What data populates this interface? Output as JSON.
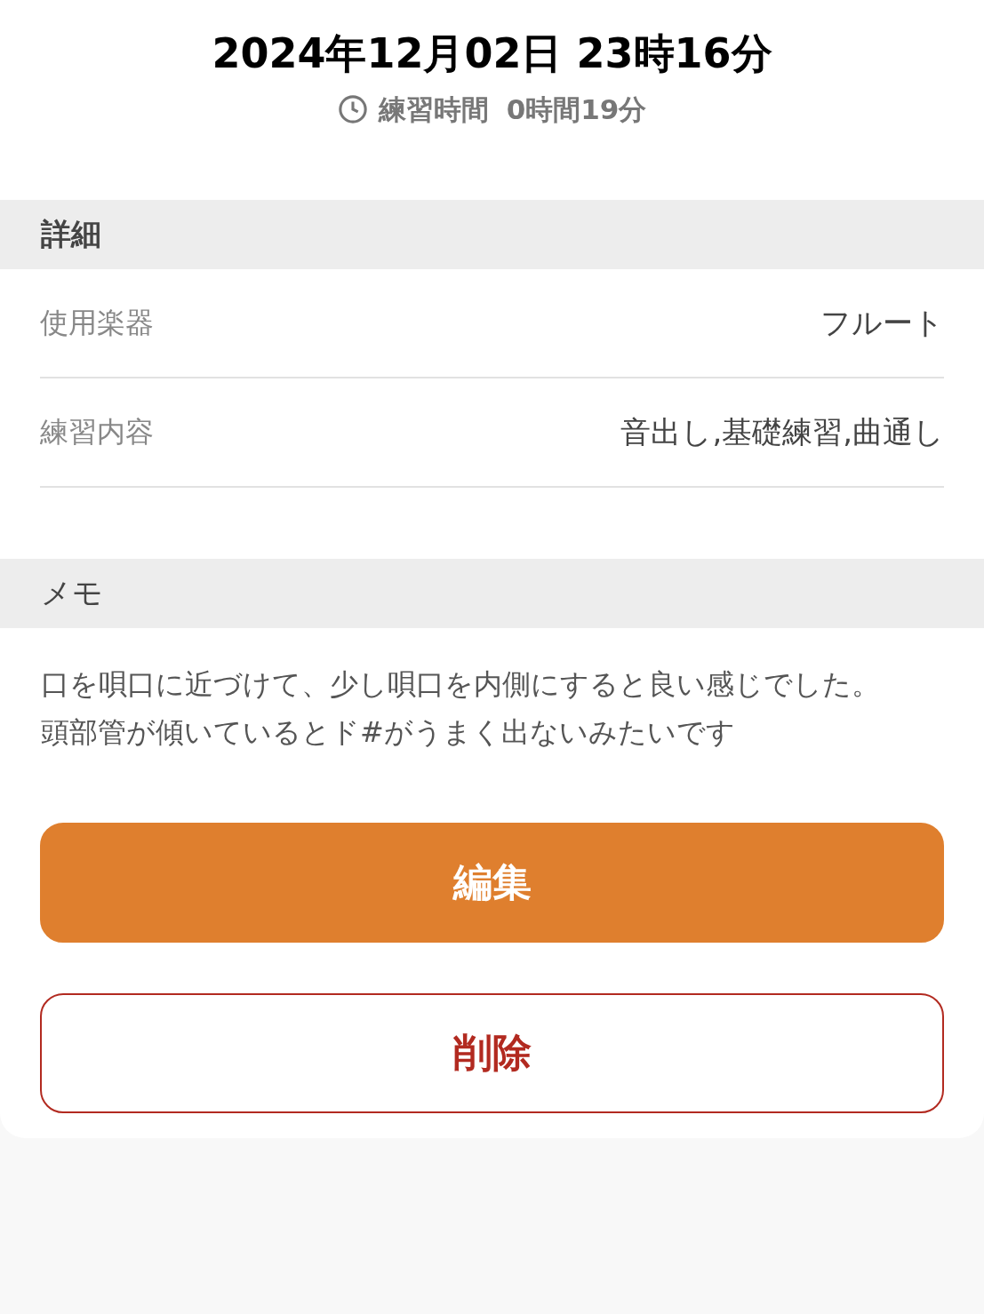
{
  "header": {
    "datetime": "2024年12月02日 23時16分",
    "practice_label": "練習時間",
    "practice_time": "0時間19分"
  },
  "details": {
    "title": "詳細",
    "rows": [
      {
        "label": "使用楽器",
        "value": "フルート"
      },
      {
        "label": "練習内容",
        "value": "音出し,基礎練習,曲通し"
      }
    ]
  },
  "memo": {
    "title": "メモ",
    "paragraphs": [
      "口を唄口に近づけて、少し唄口を内側にすると良い感じでした。",
      "頭部管が傾いているとド#がうまく出ないみたいです"
    ]
  },
  "buttons": [
    {
      "label": "編集",
      "kind": "primary"
    },
    {
      "label": "削除",
      "kind": "danger"
    }
  ]
}
